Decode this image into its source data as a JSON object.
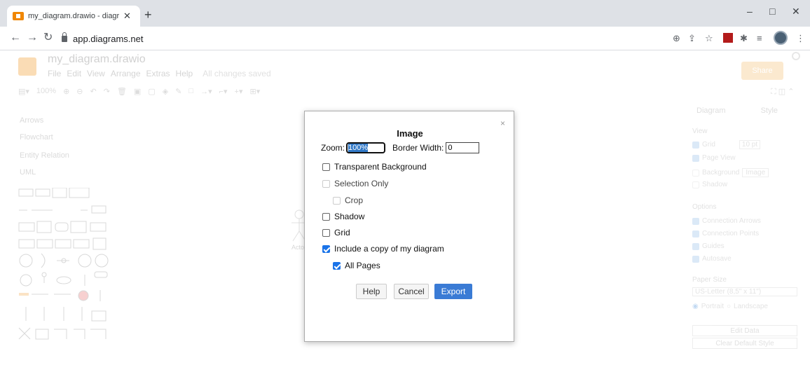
{
  "browser": {
    "tab_title": "my_diagram.drawio - diagrams.n",
    "tab_close": "✕",
    "new_tab": "+",
    "url": "app.diagrams.net",
    "minimize": "–",
    "maximize": "□",
    "close": "✕"
  },
  "app": {
    "title": "my_diagram.drawio",
    "menu": [
      "File",
      "Edit",
      "View",
      "Arrange",
      "Extras",
      "Help"
    ],
    "save_status": "All changes saved",
    "share_label": "Share",
    "zoom_level": "100%"
  },
  "sidebar": {
    "items": [
      "Arrows",
      "Flowchart",
      "Entity Relation",
      "UML"
    ]
  },
  "canvas": {
    "actor_label": "Acto"
  },
  "right_panel": {
    "tabs": [
      "Diagram",
      "Style"
    ],
    "view_title": "View",
    "grid_label": "Grid",
    "grid_size": "10 pt",
    "page_view_label": "Page View",
    "background_label": "Background",
    "image_btn": "Image",
    "shadow_label": "Shadow",
    "options_title": "Options",
    "options": [
      "Connection Arrows",
      "Connection Points",
      "Guides",
      "Autosave"
    ],
    "paper_size_title": "Paper Size",
    "paper_size_value": "US-Letter (8,5\" x 11\")",
    "portrait_label": "Portrait",
    "landscape_label": "Landscape",
    "edit_data_label": "Edit Data",
    "clear_default_style_label": "Clear Default Style"
  },
  "dialog": {
    "title": "Image",
    "close": "×",
    "zoom_label": "Zoom:",
    "zoom_value": "100%",
    "border_width_label": "Border Width:",
    "border_width_value": "0",
    "options": {
      "transparent_background": "Transparent Background",
      "selection_only": "Selection Only",
      "crop": "Crop",
      "shadow": "Shadow",
      "grid": "Grid",
      "include_copy": "Include a copy of my diagram",
      "all_pages": "All Pages"
    },
    "checked": {
      "transparent_background": false,
      "selection_only": false,
      "crop": false,
      "shadow": false,
      "grid": false,
      "include_copy": true,
      "all_pages": true
    },
    "buttons": {
      "help": "Help",
      "cancel": "Cancel",
      "export": "Export"
    }
  }
}
